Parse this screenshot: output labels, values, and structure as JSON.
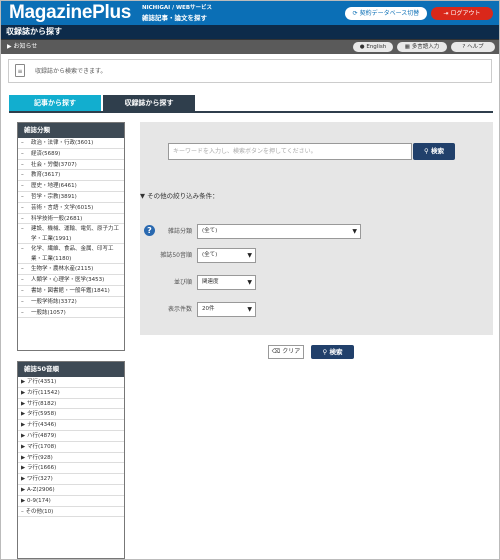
{
  "header": {
    "logo": "MagazinePlus",
    "sub_line1": "NICHIGAI / WEBサービス",
    "sub_line2": "雑誌記事・論文を探す",
    "contract_db_button": "契約データベース切替",
    "logout_button": "ログアウト"
  },
  "title": "収録誌から探す",
  "subbar": {
    "notice": "▶ お知らせ",
    "english": "English",
    "multi_input": "多言語入力",
    "help": "ヘルプ"
  },
  "info": {
    "text": "収録誌から検索できます。"
  },
  "tabs": [
    {
      "label": "記事から探す",
      "active": false
    },
    {
      "label": "収録誌から探す",
      "active": true
    }
  ],
  "category_panel": {
    "title": "雑誌分類",
    "items": [
      "政治・法律・行政(3601)",
      "経済(5689)",
      "社会・労働(3707)",
      "教育(3617)",
      "歴史・地理(6461)",
      "哲学・宗教(3891)",
      "芸術・言語・文学(6015)",
      "科学技術一般(2681)",
      "建設、機械、運輸、電気、原子力工学・工業(1991)",
      "化学、繊維、食品、金属、印写工業・工業(1180)",
      "生物学・農林水産(2115)",
      "人類学・心理学・医学(3453)",
      "書誌・図書館・一般年鑑(1841)",
      "一般学術誌(3372)",
      "一般誌(1057)"
    ]
  },
  "syllabary_panel": {
    "title": "雑誌50音順",
    "items": [
      "ア行(4351)",
      "カ行(11542)",
      "サ行(8182)",
      "タ行(5958)",
      "ナ行(4346)",
      "ハ行(4879)",
      "マ行(1708)",
      "ヤ行(928)",
      "ラ行(1666)",
      "ワ行(327)",
      "A-Z(2906)",
      "0-9(174)",
      "その他(10)"
    ]
  },
  "search": {
    "placeholder": "キーワードを入力し、検索ボタンを押してください。",
    "button": "検索",
    "conditions_label": "▼ その他の絞り込み条件：",
    "filters": [
      {
        "label": "雑誌分類",
        "value": "(全て)"
      },
      {
        "label": "雑誌50音順",
        "value": "(全て)"
      },
      {
        "label": "並び順",
        "value": "関連度"
      },
      {
        "label": "表示件数",
        "value": "20件"
      }
    ],
    "clear_button": "クリア",
    "search_button": "検索"
  },
  "colors": {
    "header_bg": "#0b6fb6",
    "title_bg": "#0d2b4a",
    "active_tab": "#12aecf",
    "inactive_tab": "#2f3e4c",
    "search_button": "#21406b",
    "logout": "#d9281a"
  }
}
